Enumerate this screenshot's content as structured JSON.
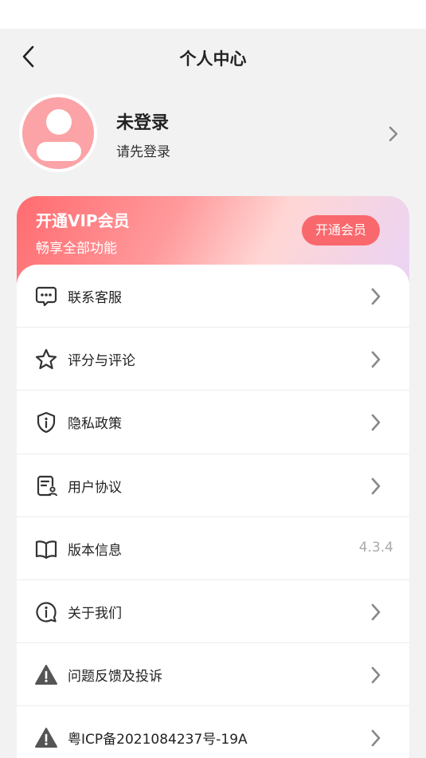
{
  "header": {
    "title": "个人中心"
  },
  "profile": {
    "name": "未登录",
    "subtitle": "请先登录"
  },
  "vip": {
    "title": "开通VIP会员",
    "subtitle": "畅享全部功能",
    "button_label": "开通会员"
  },
  "menu": {
    "items": [
      {
        "label": "联系客服",
        "icon": "chat-bubble-icon"
      },
      {
        "label": "评分与评论",
        "icon": "star-icon"
      },
      {
        "label": "隐私政策",
        "icon": "shield-info-icon"
      },
      {
        "label": "用户协议",
        "icon": "document-user-icon"
      },
      {
        "label": "版本信息",
        "icon": "book-icon",
        "value": "4.3.4"
      },
      {
        "label": "关于我们",
        "icon": "info-circle-icon"
      },
      {
        "label": "问题反馈及投诉",
        "icon": "warning-icon"
      },
      {
        "label": "粤ICP备2021084237号-19A",
        "icon": "warning-icon"
      }
    ]
  },
  "colors": {
    "accent": "#f9686c",
    "avatar_bg": "#fba3a6",
    "page_bg": "#f2f2f2"
  }
}
